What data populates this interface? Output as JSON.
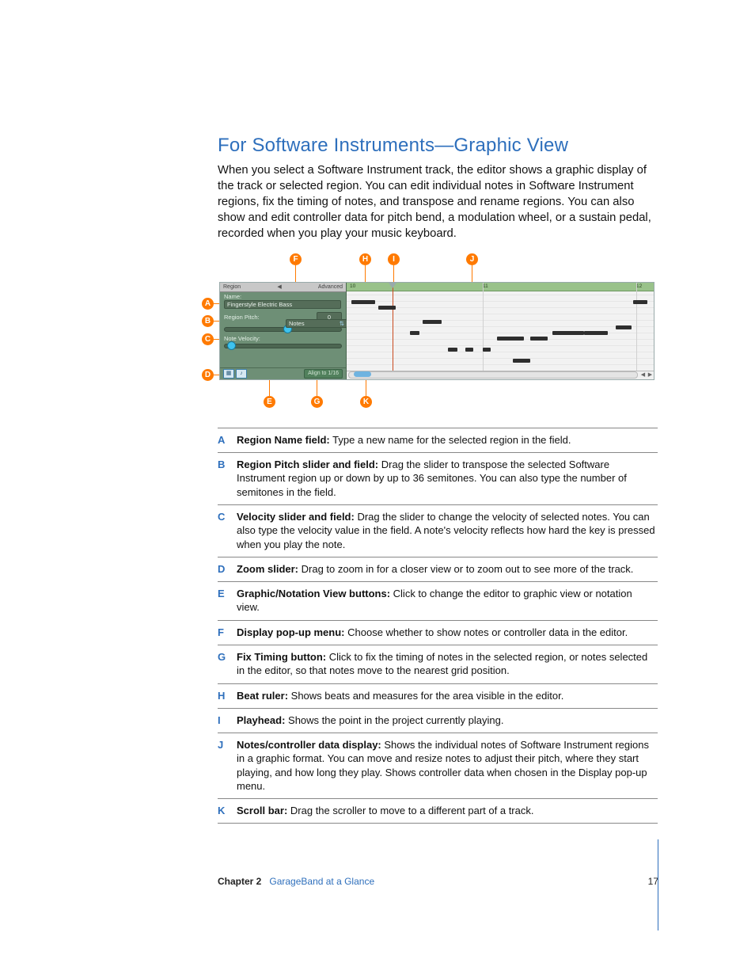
{
  "title": "For Software Instruments—Graphic View",
  "intro": "When you select a Software Instrument track, the editor shows a graphic display of the track or selected region. You can edit individual notes in Software Instrument regions, fix the timing of notes, and transpose and rename regions. You can also show and edit controller data for pitch bend, a modulation wheel, or a sustain pedal, recorded when you play your music keyboard.",
  "figure": {
    "panel_header_left": "Region",
    "panel_header_right": "Advanced",
    "name_label": "Name:",
    "name_value": "Fingerstyle Electric Bass",
    "pitch_label": "Region Pitch:",
    "pitch_value": "0",
    "velocity_label": "Note Velocity:",
    "display_menu": "Notes",
    "align_button": "Align to 1/16",
    "ruler_ticks": [
      "10",
      "11",
      "12"
    ]
  },
  "callouts_top": {
    "F": "F",
    "H": "H",
    "I": "I",
    "J": "J"
  },
  "callouts_left": {
    "A": "A",
    "B": "B",
    "C": "C",
    "D": "D"
  },
  "callouts_bottom": {
    "E": "E",
    "G": "G",
    "K": "K"
  },
  "defs": [
    {
      "letter": "A",
      "term": "Region Name field:",
      "text": " Type a new name for the selected region in the field."
    },
    {
      "letter": "B",
      "term": "Region Pitch slider and field:",
      "text": " Drag the slider to transpose the selected Software Instrument region up or down by up to 36 semitones. You can also type the number of semitones in the field."
    },
    {
      "letter": "C",
      "term": "Velocity slider and field:",
      "text": " Drag the slider to change the velocity of selected notes. You can also type the velocity value in the field. A note's velocity reflects how hard the key is pressed when you play the note."
    },
    {
      "letter": "D",
      "term": "Zoom slider:",
      "text": " Drag to zoom in for a closer view or to zoom out to see more of the track."
    },
    {
      "letter": "E",
      "term": "Graphic/Notation View buttons:",
      "text": " Click to change the editor to graphic view or notation view."
    },
    {
      "letter": "F",
      "term": "Display pop-up menu:",
      "text": " Choose whether to show notes or controller data in the editor."
    },
    {
      "letter": "G",
      "term": "Fix Timing button:",
      "text": " Click to fix the timing of notes in the selected region, or notes selected in the editor, so that notes move to the nearest grid position."
    },
    {
      "letter": "H",
      "term": "Beat ruler:",
      "text": " Shows beats and measures for the area visible in the editor."
    },
    {
      "letter": "I",
      "term": "Playhead:",
      "text": " Shows the point in the project currently playing."
    },
    {
      "letter": "J",
      "term": "Notes/controller data display:",
      "text": " Shows the individual notes of Software Instrument regions in a graphic format. You can move and resize notes to adjust their pitch, where they start playing, and how long they play. Shows controller data when chosen in the Display pop-up menu."
    },
    {
      "letter": "K",
      "term": "Scroll bar:",
      "text": " Drag the scroller to move to a different part of a track."
    }
  ],
  "footer": {
    "chapter_label": "Chapter 2",
    "chapter_name": "GarageBand at a Glance",
    "page_number": "17"
  }
}
